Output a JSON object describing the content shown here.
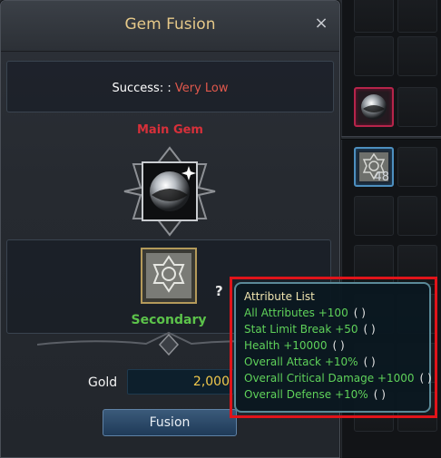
{
  "window": {
    "title": "Gem Fusion",
    "close_symbol": "×"
  },
  "success": {
    "label": "Success: :",
    "value": "Very Low"
  },
  "main_gem": {
    "label": "Main Gem"
  },
  "secondary": {
    "label": "Secondary"
  },
  "help": {
    "symbol": "?"
  },
  "gold": {
    "label": "Gold",
    "value": "2,000"
  },
  "fusion_button": {
    "label": "Fusion"
  },
  "inventory": {
    "selected_stack_count": "48"
  },
  "tooltip": {
    "title": "Attribute List",
    "rows": [
      {
        "text": "All Attributes +100",
        "paren": "( )"
      },
      {
        "text": "Stat Limit Break +50",
        "paren": "( )"
      },
      {
        "text": "Health +10000",
        "paren": "( )"
      },
      {
        "text": "Overall Attack +10%",
        "paren": "( )"
      },
      {
        "text": "Overall Critical Damage +1000",
        "paren": "( )"
      },
      {
        "text": "Overall Defense +10%",
        "paren": "( )"
      }
    ]
  },
  "colors": {
    "title_gold": "#e6c989",
    "success_red": "#e0584c",
    "main_gem_red": "#d7303a",
    "secondary_green": "#5cc34a",
    "tooltip_green": "#5fd25a",
    "highlight_red": "#e0141a"
  }
}
